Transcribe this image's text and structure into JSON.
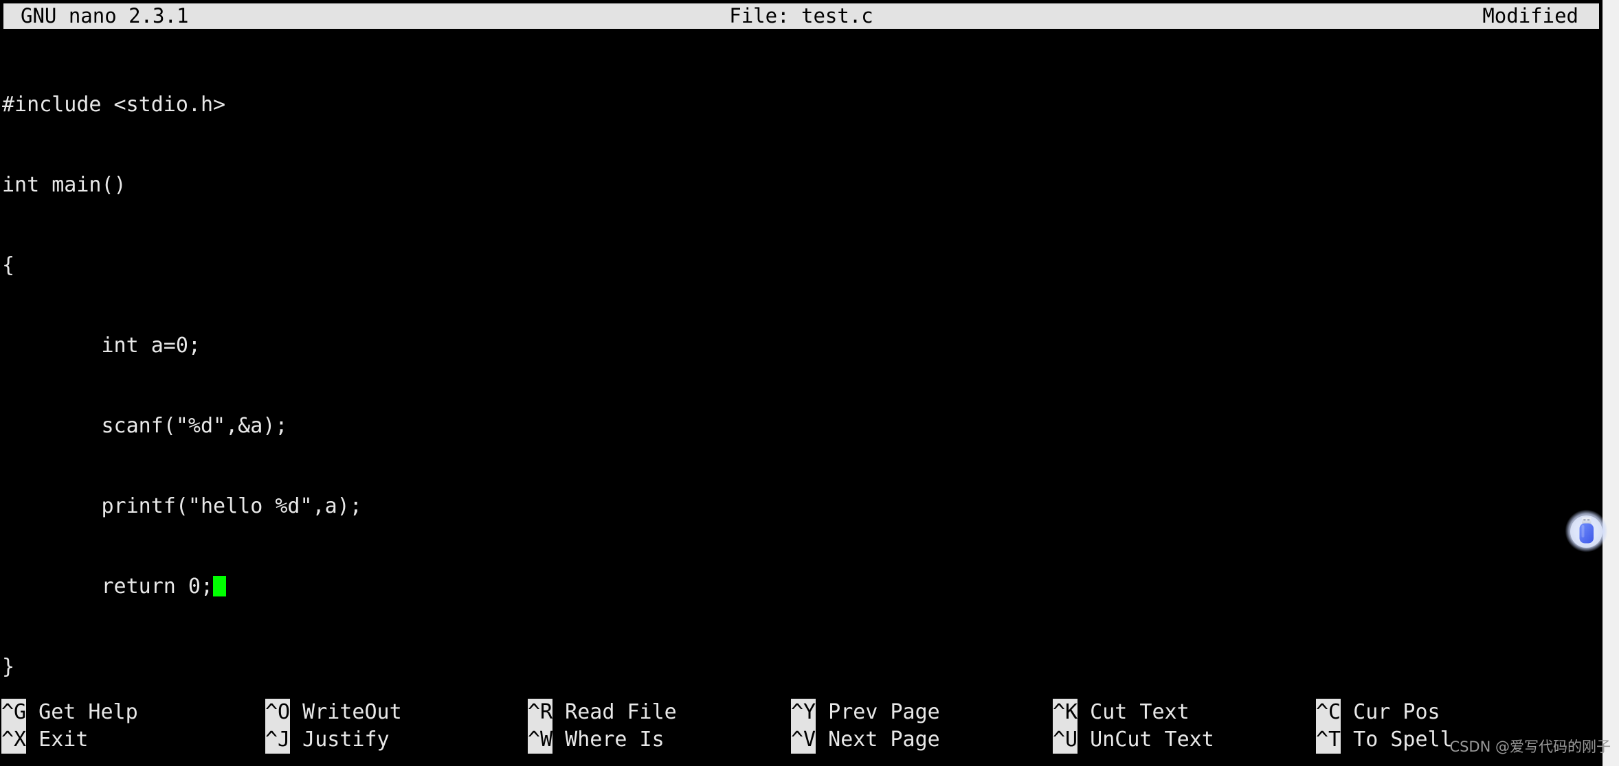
{
  "titlebar": {
    "app_version": "GNU nano 2.3.1",
    "file_label": "File: test.c",
    "status": "Modified",
    "bg_color": "#e3e3e3",
    "fg_color": "#000000"
  },
  "editor": {
    "text_color": "#e8e8e8",
    "bg_color": "#000000",
    "cursor_color": "#00ff00",
    "lines": [
      "#include <stdio.h>",
      "int main()",
      "{",
      "        int a=0;",
      "        scanf(\"%d\",&a);",
      "        printf(\"hello %d\",a);",
      "        return 0;",
      "}"
    ],
    "cursor_line_index": 6,
    "cursor_line_prefix": "        return 0;"
  },
  "helpbar": {
    "columns": [
      {
        "rows": [
          {
            "key": "^G",
            "label": " Get Help"
          },
          {
            "key": "^X",
            "label": " Exit"
          }
        ]
      },
      {
        "rows": [
          {
            "key": "^O",
            "label": " WriteOut"
          },
          {
            "key": "^J",
            "label": " Justify"
          }
        ]
      },
      {
        "rows": [
          {
            "key": "^R",
            "label": " Read File"
          },
          {
            "key": "^W",
            "label": " Where Is"
          }
        ]
      },
      {
        "rows": [
          {
            "key": "^Y",
            "label": " Prev Page"
          },
          {
            "key": "^V",
            "label": " Next Page"
          }
        ]
      },
      {
        "rows": [
          {
            "key": "^K",
            "label": " Cut Text"
          },
          {
            "key": "^U",
            "label": " UnCut Text"
          }
        ]
      },
      {
        "rows": [
          {
            "key": "^C",
            "label": " Cur Pos"
          },
          {
            "key": "^T",
            "label": " To Spell"
          }
        ]
      }
    ]
  },
  "overlay": {
    "usb_icon_name": "usb-drive-icon",
    "usb_icon_color": "#4f6ff0",
    "watermark": "CSDN @爱写代码的刚子"
  }
}
